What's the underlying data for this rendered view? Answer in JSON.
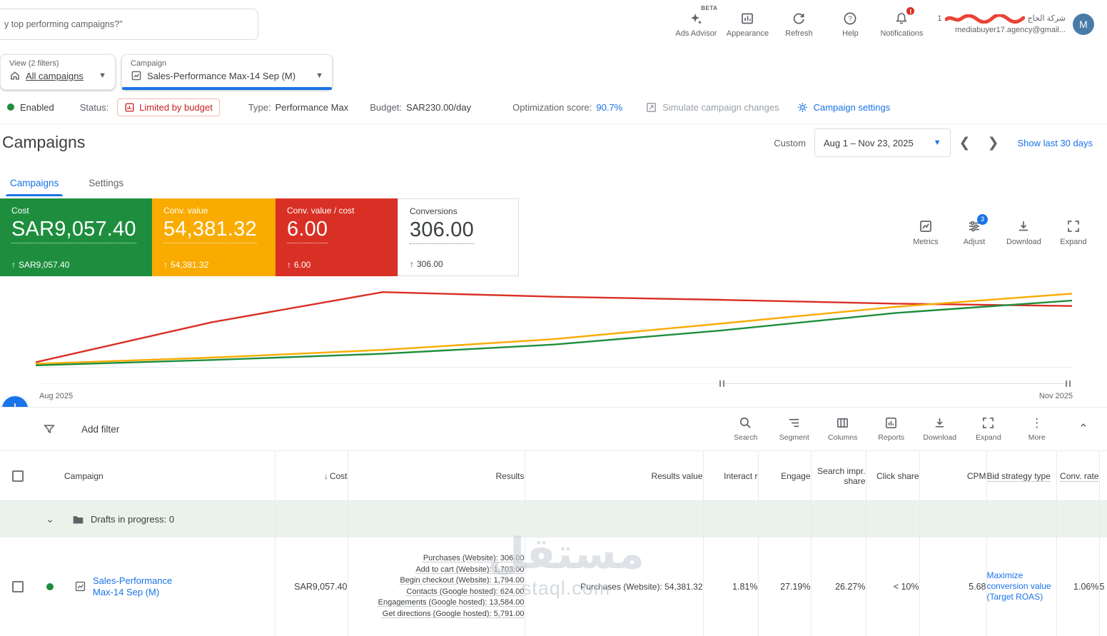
{
  "colors": {
    "accent_blue": "#1a73e8",
    "cost_green": "#1e8e3e",
    "conv_value_yellow": "#f9ab00",
    "conv_value_cost_red": "#d93025",
    "limited_budget_red": "#c5221f"
  },
  "topbar": {
    "search_value": "y top performing campaigns?\"",
    "ads_advisor": {
      "label": "Ads Advisor",
      "beta": "BETA"
    },
    "appearance": {
      "label": "Appearance"
    },
    "refresh": {
      "label": "Refresh"
    },
    "help": {
      "label": "Help"
    },
    "notifications": {
      "label": "Notifications",
      "badge": "!"
    },
    "account": {
      "phone_prefix": "1",
      "name_arabic": "شركة الحاج",
      "email": "mediabuyer17.agency@gmail...",
      "avatar_initial": "M"
    }
  },
  "filters": {
    "view": {
      "label": "View (2 filters)",
      "value": "All campaigns"
    },
    "campaign": {
      "label": "Campaign",
      "value": "Sales-Performance Max-14 Sep (M)"
    }
  },
  "status_bar": {
    "enabled": "Enabled",
    "status_label": "Status:",
    "status_value": "Limited by budget",
    "type_label": "Type:",
    "type_value": "Performance Max",
    "budget_label": "Budget:",
    "budget_value": "SAR230.00/day",
    "optimization_label": "Optimization score:",
    "optimization_value": "90.7%",
    "simulate_label": "Simulate campaign changes",
    "settings_label": "Campaign settings"
  },
  "page": {
    "title": "Campaigns",
    "date_mode": "Custom",
    "date_range": "Aug 1 – Nov 23, 2025",
    "show_last_30": "Show last 30 days"
  },
  "tabs": [
    {
      "label": "Campaigns"
    },
    {
      "label": "Settings"
    }
  ],
  "scorecards": [
    {
      "label": "Cost",
      "value": "SAR9,057.40",
      "delta": "SAR9,057.40",
      "bg": "#1e8e3e"
    },
    {
      "label": "Conv. value",
      "value": "54,381.32",
      "delta": "54,381.32",
      "bg": "#f9ab00"
    },
    {
      "label": "Conv. value / cost",
      "value": "6.00",
      "delta": "6.00",
      "bg": "#d93025"
    },
    {
      "label": "Conversions",
      "value": "306.00",
      "delta": "306.00",
      "bg": "#ffffff"
    }
  ],
  "card_actions": [
    {
      "label": "Metrics"
    },
    {
      "label": "Adjust",
      "badge": "3"
    },
    {
      "label": "Download"
    },
    {
      "label": "Expand"
    }
  ],
  "chart_data": {
    "type": "line",
    "x_axis_labels": {
      "left": "Aug 2025",
      "right": "Nov 2025"
    },
    "x_fractions": [
      0,
      0.17,
      0.335,
      0.5,
      0.66,
      0.83,
      1
    ],
    "y_scale": "relative 0-1; no y-axis tick labels shown in UI",
    "series": [
      {
        "name": "conv-value-per-cost",
        "color": "#d93025",
        "values": [
          0.06,
          0.58,
          0.97,
          0.91,
          0.87,
          0.82,
          0.79
        ]
      },
      {
        "name": "conv-value",
        "color": "#f9ab00",
        "values": [
          0.04,
          0.12,
          0.22,
          0.36,
          0.56,
          0.78,
          0.95
        ]
      },
      {
        "name": "cost",
        "color": "#1e8e3e",
        "values": [
          0.02,
          0.09,
          0.17,
          0.29,
          0.47,
          0.7,
          0.86
        ]
      }
    ]
  },
  "toolbar": {
    "add_filter": "Add filter",
    "actions": [
      {
        "label": "Search"
      },
      {
        "label": "Segment"
      },
      {
        "label": "Columns"
      },
      {
        "label": "Reports"
      },
      {
        "label": "Download"
      },
      {
        "label": "Expand"
      },
      {
        "label": "More"
      }
    ]
  },
  "table": {
    "columns": {
      "campaign": "Campaign",
      "cost": "Cost",
      "results": "Results",
      "results_value": "Results value",
      "interact_rate": "Interact r",
      "engage": "Engage",
      "search_impr_share": "Search impr. share",
      "click_share": "Click share",
      "cpm": "CPM",
      "bid_strategy_type": "Bid strategy type",
      "conv_rate": "Conv. rate"
    },
    "drafts_row_label": "Drafts in progress: 0",
    "row": {
      "name": "Sales-Performance Max-14 Sep (M)",
      "cost": "SAR9,057.40",
      "results": [
        "Purchases (Website): 306.00",
        "Add to cart (Website): 1,703.00",
        "Begin checkout (Website): 1,794.00",
        "Contacts (Google hosted): 624.00",
        "Engagements (Google hosted): 13,584.00",
        "Get directions (Google hosted): 5,791.00"
      ],
      "results_value": "Purchases (Website): 54,381.32",
      "interact_rate": "1.81%",
      "engage": "27.19%",
      "search_impr_share": "26.27%",
      "click_share": "< 10%",
      "cpm": "5.68",
      "bid_strategy": "Maximize conversion value (Target ROAS)",
      "conv_rate": "1.06%",
      "clipped_next_value": "5"
    }
  },
  "watermark": {
    "line1": "مستقل",
    "line2": "staql.com"
  }
}
